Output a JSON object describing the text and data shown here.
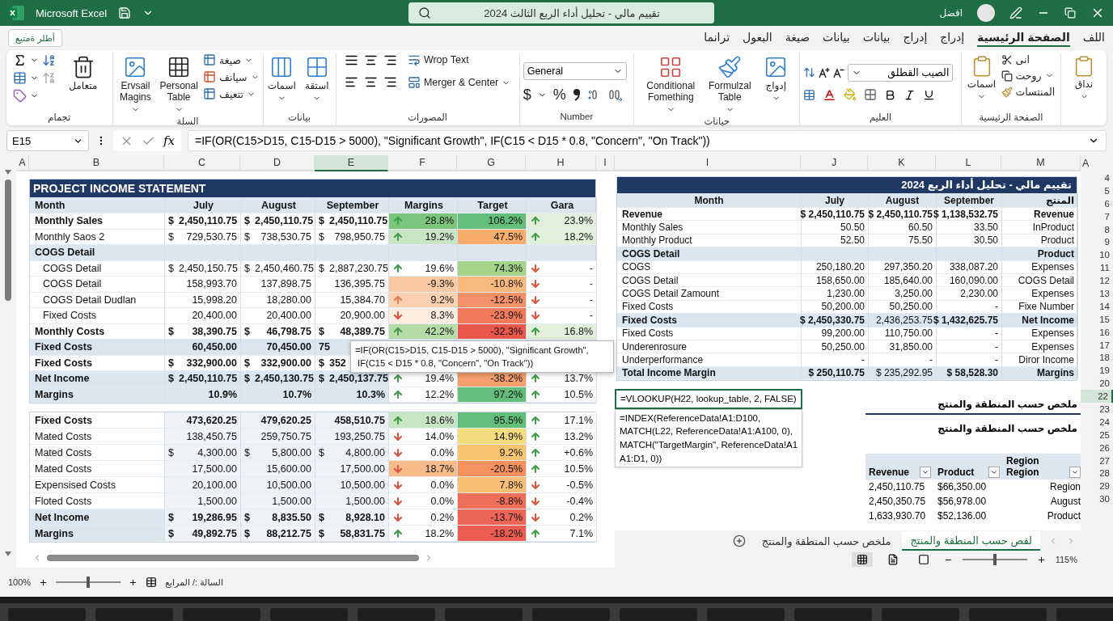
{
  "window": {
    "app": "Microsoft Excel",
    "title": "تقييم مالي - تحليل أداء الربع الثالث 2024",
    "user": "افضل"
  },
  "menu": {
    "button": "أطلر ةمتيع",
    "tabs": [
      {
        "label": "اللف",
        "selected": false
      },
      {
        "label": "الصفحة الرئيسية",
        "selected": true
      },
      {
        "label": "إدراج",
        "selected": false
      },
      {
        "label": "إدراج",
        "selected": false
      },
      {
        "label": "بيانات",
        "selected": false
      },
      {
        "label": "بيانات",
        "selected": false
      },
      {
        "label": "صيغة",
        "selected": false
      },
      {
        "label": "البعول",
        "selected": false
      },
      {
        "label": "ترانما",
        "selected": false
      }
    ]
  },
  "ribbon": {
    "groups": [
      {
        "buttons": [
          "نداق"
        ]
      },
      {
        "label": "الصفحة الرئيسية",
        "buttons": [
          "اسمات"
        ],
        "menu": [
          "انى",
          "روحت",
          "المنتسات"
        ]
      },
      {
        "label": "العليم",
        "font": "الصيب القطلق"
      },
      {
        "label": "حيانات",
        "buttons": [
          "Conditional Fomething",
          "Formulzal Table",
          "إدواج"
        ]
      },
      {
        "label": "Number",
        "format": "General",
        "symbols": [
          "$",
          "%"
        ]
      },
      {
        "label": "المصورات",
        "buttons": [
          "Wrop Text",
          "Merger & Center"
        ]
      },
      {
        "label": "بيانات",
        "buttons": [
          "استقة",
          "اسمات"
        ]
      },
      {
        "label": "السلة",
        "buttons": [
          "Ervsail Magins",
          "Personal Table"
        ],
        "menu": [
          "صيغة",
          "سيانف",
          "تتعيف"
        ]
      },
      {
        "label": "تجمام",
        "buttons": [
          "متعامل"
        ]
      }
    ]
  },
  "formula_bar": {
    "cell": "E15",
    "fx": "fx",
    "formula": "=IF(OR(C15>D15, C15-D15 > 5000), \"Significant Growth\", IF(C15 < D15 * 0.8, \"Concern\", \"On Track\"))"
  },
  "left_columns": [
    {
      "label": "A",
      "selected": false
    },
    {
      "label": "B",
      "selected": false
    },
    {
      "label": "C",
      "selected": false
    },
    {
      "label": "D",
      "selected": false
    },
    {
      "label": "E",
      "selected": true
    },
    {
      "label": "F",
      "selected": false
    },
    {
      "label": "G",
      "selected": false
    },
    {
      "label": "H",
      "selected": false
    },
    {
      "label": "I",
      "selected": false
    }
  ],
  "income": {
    "title": "PROJECT INCOME STATEMENT",
    "header": [
      "Month",
      "July",
      "August",
      "September",
      "Margins",
      "Target",
      "Gara"
    ],
    "rows": [
      {
        "kind": "bold",
        "label": "Monthly Sales",
        "currency": "$",
        "values": [
          "2,450,110.75",
          "2,450,110.75",
          "2,450,110.75"
        ],
        "margin": {
          "kind": "up",
          "value": "28.8%",
          "color": "#7cc57d"
        },
        "target": {
          "value": "106.2%",
          "color": "#63be7b"
        },
        "gara": {
          "kind": "up",
          "value": "23.9%",
          "color": "#e2efda"
        }
      },
      {
        "kind": "item",
        "label": "Monthly Saos 2",
        "currency": "$",
        "values": [
          "729,530.75",
          "738,530.75",
          "798,950.75"
        ],
        "margin": {
          "kind": "up",
          "value": "19.2%",
          "color": "#c9e6c4"
        },
        "target": {
          "value": "47.5%",
          "color": "#f8ad6c"
        },
        "gara": {
          "kind": "up",
          "value": "18.2%",
          "color": "#e2efda"
        }
      },
      {
        "kind": "section",
        "label": "COGS Detail",
        "values": []
      },
      {
        "kind": "sub",
        "label": "COGS Detail",
        "currency": "$",
        "values": [
          "2,450,150.75",
          "2,450,460.75",
          "2,887,230.75"
        ],
        "margin": {
          "kind": "up",
          "value": "19.6%",
          "color": "#ffffff"
        },
        "target": {
          "value": "74.3%",
          "color": "#a4d38a"
        },
        "gara": {
          "kind": "down",
          "value": "-",
          "color": "#ffffff"
        }
      },
      {
        "kind": "sub",
        "label": "COGS Detail",
        "values": [
          "158,993.70",
          "137,898.75",
          "136,395.75"
        ],
        "margin": {
          "kind": "none",
          "value": "-9.3%",
          "color": "#f9c9a3"
        },
        "target": {
          "value": "-10.8%",
          "color": "#f9b87c"
        },
        "gara": {
          "kind": "down",
          "value": "-",
          "color": "#ffffff"
        }
      },
      {
        "kind": "sub",
        "label": "COGS Detail Dudlan",
        "values": [
          "15,998.20",
          "18,280.00",
          "15,384.70"
        ],
        "margin": {
          "kind": "warn",
          "value": "9.2%",
          "color": "#fbd0b0"
        },
        "target": {
          "value": "-12.5%",
          "color": "#f49168"
        },
        "gara": {
          "kind": "down",
          "value": "-",
          "color": "#ffffff"
        }
      },
      {
        "kind": "sub",
        "label": "Fixed Costs",
        "values": [
          "20,400.00",
          "20,400.00",
          "20,900.00"
        ],
        "margin": {
          "kind": "down",
          "value": "8.3%",
          "color": "#fdeee0"
        },
        "target": {
          "value": "-23.9%",
          "color": "#f17a5d"
        },
        "gara": {
          "kind": "down",
          "value": "-",
          "color": "#ffffff"
        }
      },
      {
        "kind": "bold",
        "label": "Monthly Costs",
        "currency": "$",
        "values": [
          "38,390.75",
          "46,798.75",
          "48,389.75"
        ],
        "margin": {
          "kind": "up",
          "value": "42.2%",
          "color": "#b5dba8"
        },
        "target": {
          "value": "-32.3%",
          "color": "#e9564c"
        },
        "gara": {
          "kind": "up",
          "value": "16.8%",
          "color": "#e2efda"
        }
      },
      {
        "kind": "band",
        "label": "Fixed Costs",
        "clipped": true,
        "values": [
          "60,450.00",
          "70,450.00",
          "75"
        ]
      },
      {
        "kind": "bold",
        "label": "Fixed Costs",
        "clipped": true,
        "currency": "$",
        "values": [
          "332,900.00",
          "332,900.00",
          "352"
        ]
      },
      {
        "kind": "band",
        "label": "Net Income",
        "currency": "$",
        "values": [
          "2,450,110.75",
          "2,450,130.75",
          "2,450,137.75"
        ],
        "margin": {
          "kind": "up",
          "value": "19.4%",
          "color": "#ffffff"
        },
        "target": {
          "value": "-38.2%",
          "color": "#f6a16d"
        },
        "gara": {
          "kind": "up",
          "value": "13.7%",
          "color": "#ffffff"
        }
      },
      {
        "kind": "band",
        "label": "Margins",
        "values": [
          "10.9%",
          "10.7%",
          "10.3%"
        ],
        "margin": {
          "kind": "up",
          "value": "12.2%",
          "color": "#ffffff"
        },
        "target": {
          "value": "97.2%",
          "color": "#63be7b"
        },
        "gara": {
          "kind": "up",
          "value": "10.5%",
          "color": "#ffffff"
        }
      }
    ]
  },
  "tooltip": "=IF(OR(C15>D15, C15-D15 > 5000), \"Significant Growth\",\n IF(C15 < D15 * 0.8, \"Concern\", \"On Track\"))",
  "costs": {
    "rows": [
      {
        "kind": "bold",
        "label": "Fixed Costs",
        "values": [
          "473,620.25",
          "479,620.25",
          "458,510.75"
        ],
        "margin": {
          "kind": "up",
          "value": "18.6%",
          "color": "#c9e6c4"
        },
        "target": {
          "value": "95.5%",
          "color": "#63be7b"
        },
        "gara": {
          "kind": "up",
          "value": "17.1%",
          "color": "#ffffff"
        }
      },
      {
        "kind": "item",
        "label": "Mated Costs",
        "values": [
          "138,450.75",
          "259,750.75",
          "193,250.75"
        ],
        "margin": {
          "kind": "down",
          "value": "14.0%",
          "color": "#ffffff"
        },
        "target": {
          "value": "14.9%",
          "color": "#f3dc7c"
        },
        "gara": {
          "kind": "up",
          "value": "13.2%",
          "color": "#ffffff"
        }
      },
      {
        "kind": "item",
        "label": "Mated Costs",
        "currency": "$",
        "values": [
          "4,300.00",
          "5,800.00",
          "4,800.00"
        ],
        "margin": {
          "kind": "down",
          "value": "0.0%",
          "color": "#ffffff"
        },
        "target": {
          "value": "9.2%",
          "color": "#f7c56f"
        },
        "gara": {
          "kind": "up",
          "value": "+0.6%",
          "color": "#ffffff"
        }
      },
      {
        "kind": "item",
        "label": "Mated Costs",
        "values": [
          "17,500.00",
          "15,600.00",
          "17,500.00"
        ],
        "margin": {
          "kind": "down",
          "value": "18.7%",
          "color": "#f8bb8c"
        },
        "target": {
          "value": "-20.5%",
          "color": "#f4915f"
        },
        "gara": {
          "kind": "up",
          "value": "10.5%",
          "color": "#ffffff"
        }
      },
      {
        "kind": "item",
        "label": "Expensised Costs",
        "values": [
          "20,100.00",
          "10,500.00",
          "10,500.00"
        ],
        "margin": {
          "kind": "down",
          "value": "0.0%",
          "color": "#ffffff"
        },
        "target": {
          "value": "7.8%",
          "color": "#f8bf75"
        },
        "gara": {
          "kind": "down",
          "value": "-0.5%",
          "color": "#ffffff"
        }
      },
      {
        "kind": "item",
        "label": "Floted Costs",
        "values": [
          "1,500.00",
          "1,500.00",
          "1,500.00"
        ],
        "margin": {
          "kind": "down",
          "value": "0.0%",
          "color": "#ffffff"
        },
        "target": {
          "value": "-8.8%",
          "color": "#ee6e59"
        },
        "gara": {
          "kind": "down",
          "value": "-0.4%",
          "color": "#ffffff"
        }
      },
      {
        "kind": "band",
        "label": "Net Income",
        "currency": "$",
        "values": [
          "19,286.95",
          "8,835.50",
          "8,928.10"
        ],
        "margin": {
          "kind": "down",
          "value": "0.2%",
          "color": "#ffffff"
        },
        "target": {
          "value": "-13.7%",
          "color": "#ec6556"
        },
        "gara": {
          "kind": "down",
          "value": "0.2%",
          "color": "#ffffff"
        }
      },
      {
        "kind": "band",
        "label": "Margins",
        "currency": "$",
        "values": [
          "49,892.75",
          "88,212.75",
          "58,831.75"
        ],
        "margin": {
          "kind": "up",
          "value": "18.2%",
          "color": "#ffffff"
        },
        "target": {
          "value": "-18.2%",
          "color": "#ea5c52"
        },
        "gara": {
          "kind": "up",
          "value": "7.1%",
          "color": "#ffffff"
        }
      }
    ]
  },
  "right_columns": [
    {
      "label": "I",
      "selected": false
    },
    {
      "label": "J",
      "selected": false
    },
    {
      "label": "K",
      "selected": false
    },
    {
      "label": "L",
      "selected": false
    },
    {
      "label": "M",
      "selected": false
    }
  ],
  "edge_column": "A",
  "row_numbers": [
    {
      "label": "4",
      "selected": false
    },
    {
      "label": "5",
      "selected": false
    },
    {
      "label": "6",
      "selected": false
    },
    {
      "label": "7",
      "selected": false
    },
    {
      "label": "8",
      "selected": false
    },
    {
      "label": "9",
      "selected": false
    },
    {
      "label": "10",
      "selected": false
    },
    {
      "label": "11",
      "selected": false
    },
    {
      "label": "12",
      "selected": false
    },
    {
      "label": "13",
      "selected": false
    },
    {
      "label": "14",
      "selected": false
    },
    {
      "label": "15",
      "selected": false
    },
    {
      "label": "16",
      "selected": false
    },
    {
      "label": "17",
      "selected": false
    },
    {
      "label": "18",
      "selected": false
    },
    {
      "label": "19",
      "selected": false
    },
    {
      "label": "20",
      "selected": false
    },
    {
      "label": "22",
      "selected": true
    },
    {
      "label": "23",
      "selected": false
    },
    {
      "label": "24",
      "selected": false
    },
    {
      "label": "25",
      "selected": false
    },
    {
      "label": "26",
      "selected": false
    },
    {
      "label": "27",
      "selected": false
    },
    {
      "label": "28",
      "selected": false
    },
    {
      "label": "29",
      "selected": false
    },
    {
      "label": "30",
      "selected": false
    }
  ],
  "summary_table": {
    "title": "تقييم مالي - تحليل أداء الربع 2024",
    "header": [
      "Month",
      "July",
      "August",
      "September",
      "المنتج"
    ],
    "rows": [
      {
        "kind": "bold",
        "label": "Revenue",
        "values": [
          "$ 2,450,110.75",
          "$ 2,450,110.75",
          "$ 1,138,532.75"
        ],
        "note": "Revenue"
      },
      {
        "kind": "item",
        "label": "Monthly Sales",
        "values": [
          "50.50",
          "60.50",
          "33.50"
        ],
        "note": "InProduct"
      },
      {
        "kind": "item",
        "label": "Monthly Product",
        "values": [
          "52.50",
          "75.50",
          "30.50"
        ],
        "note": "Product"
      },
      {
        "kind": "band",
        "label": "COGS Detail",
        "values": [],
        "note": "Product"
      },
      {
        "kind": "item",
        "label": "COGS",
        "values": [
          "250,180.20",
          "297,350.20",
          "338,087.20"
        ],
        "note": "Expenses"
      },
      {
        "kind": "item",
        "label": "COGS Detail",
        "values": [
          "158,650.00",
          "185,640.00",
          "160,090.00"
        ],
        "note": "COGS Detail"
      },
      {
        "kind": "item",
        "label": "COGS Detail Zamount",
        "values": [
          "1,230.00",
          "3,250.00",
          "2,230.00"
        ],
        "note": "Expenses"
      },
      {
        "kind": "item",
        "label": "Fixed Costs",
        "values": [
          "50,200.00",
          "50,250.00",
          "-"
        ],
        "note": "Fixe Number"
      },
      {
        "kind": "band",
        "label": "Fixed Costs",
        "values": [
          "$ 2,450,330.75",
          "2,436,253.75",
          "$ 1,432,625.75"
        ],
        "note": "Net Income"
      },
      {
        "kind": "item",
        "label": "Fixed Costs",
        "values": [
          "99,200.00",
          "110,750.00",
          "-"
        ],
        "note": "Expenses"
      },
      {
        "kind": "item",
        "label": "Underenrosure",
        "values": [
          "50,250.00",
          "31,850.00",
          "-"
        ],
        "note": "Expenses"
      },
      {
        "kind": "item",
        "label": "Underperformance",
        "values": [
          "-",
          "-",
          "-"
        ],
        "note": "Diror Income"
      },
      {
        "kind": "band",
        "label": "Total Income Margin",
        "values": [
          "$   250,110.75",
          "$   235,292.95",
          "$   58,528.30"
        ],
        "note": "Margins"
      }
    ]
  },
  "formula_cells": [
    {
      "text": "=VLOOKUP(H22, lookup_table, 2, FALSE)",
      "selected": true
    },
    {
      "text": "=INDEX(ReferenceData!A1:D100,\nMATCH(L22, ReferenceData!A1:A100, 0),\nMATCH(\"TargetMargin\", ReferenceData!A1\nA1:D1, 0))",
      "selected": false
    }
  ],
  "summary_headings": [
    "ملخص حسب المنطقة والمنتج",
    "ملخص حسب المنطقة والمنتج"
  ],
  "pivot": {
    "columns": [
      "Revenue",
      "Product",
      "Region\nRegion"
    ],
    "rows": [
      [
        "2,450,110.75",
        "$66,350.00",
        "Region"
      ],
      [
        "2,450,350.75",
        "$56,978.00",
        "August"
      ],
      [
        "1,633,930.70",
        "$52,136.00",
        "Product"
      ]
    ]
  },
  "sheet_tabs": [
    {
      "label": "لفص حسب المنطقة والمنتج",
      "selected": true
    },
    {
      "label": "ملخص حسب المنطقة والمنتج",
      "selected": false
    }
  ],
  "views": [
    {
      "selected": true
    },
    {
      "selected": false
    },
    {
      "selected": false
    }
  ],
  "sheet_zoom": {
    "level": 0.5,
    "reading": "115%"
  },
  "status_bar": {
    "zoom": "100%",
    "level": 0.5,
    "text": "السالة :/ المرابع"
  }
}
